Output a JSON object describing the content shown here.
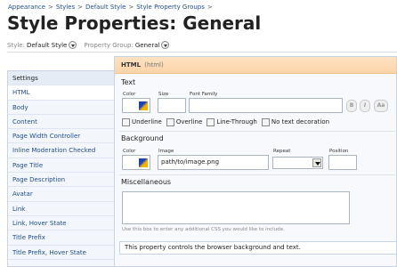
{
  "breadcrumb": {
    "items": [
      "Appearance",
      "Styles",
      "Default Style",
      "Style Property Groups"
    ],
    "separator": ">"
  },
  "page_title": "Style Properties: General",
  "filters": {
    "style_label": "Style:",
    "style_value": "Default Style",
    "group_label": "Property Group:",
    "group_value": "General"
  },
  "sidebar": {
    "items": [
      {
        "label": "Settings"
      },
      {
        "label": "HTML"
      },
      {
        "label": "Body"
      },
      {
        "label": "Content"
      },
      {
        "label": "Page Width Controller"
      },
      {
        "label": "Inline Moderation Checked"
      },
      {
        "label": "Page Title"
      },
      {
        "label": "Page Description"
      },
      {
        "label": "Avatar"
      },
      {
        "label": "Link"
      },
      {
        "label": "Link, Hover State"
      },
      {
        "label": "Title Prefix"
      },
      {
        "label": "Title Prefix, Hover State"
      }
    ]
  },
  "panel": {
    "name": "HTML",
    "code": "(html)",
    "text_section": {
      "title": "Text",
      "color_label": "Color",
      "size_label": "Size",
      "font_family_label": "Font Family",
      "size_value": "",
      "font_family_value": "",
      "decorations": [
        "Underline",
        "Overline",
        "Line-Through",
        "No text decoration"
      ],
      "format_buttons": [
        "B",
        "I",
        "Aa"
      ]
    },
    "background_section": {
      "title": "Background",
      "color_label": "Color",
      "image_label": "Image",
      "image_value": "path/to/image.png",
      "repeat_label": "Repeat",
      "repeat_value": "",
      "position_label": "Position",
      "position_value": ""
    },
    "misc_section": {
      "title": "Miscellaneous",
      "hint": "Use this box to enter any additional CSS you would like to include."
    },
    "description": "This property controls the browser background and text."
  },
  "colors": {
    "link": "#1e4d8f",
    "panel_header": "#fbd4a8",
    "sidebar_bg": "#f3f6fb",
    "border": "#c9d3e3"
  }
}
